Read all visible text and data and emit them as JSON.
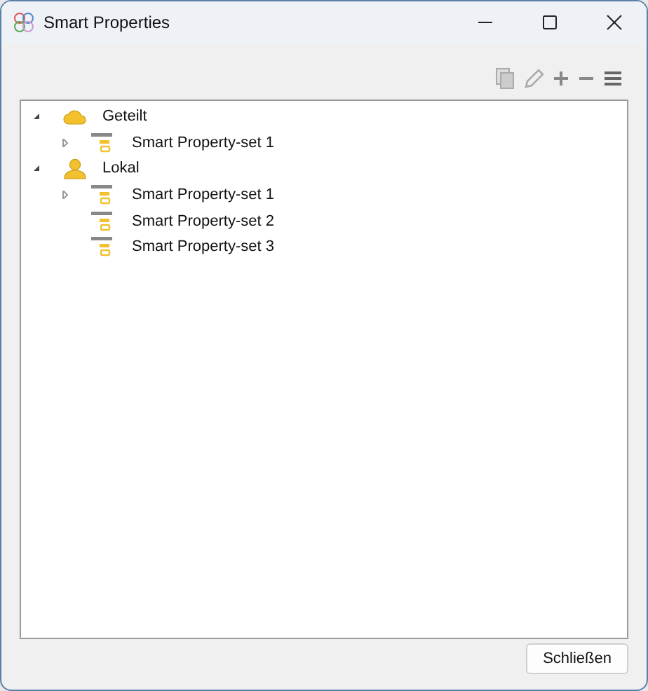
{
  "window": {
    "title": "Smart Properties"
  },
  "tree": [
    {
      "label": "Geteilt",
      "kind": "cloud",
      "expanded": true,
      "children": [
        {
          "label": "Smart Property-set 1",
          "expandable": true
        }
      ]
    },
    {
      "label": "Lokal",
      "kind": "user",
      "expanded": true,
      "children": [
        {
          "label": "Smart Property-set 1",
          "expandable": true
        },
        {
          "label": "Smart Property-set 2",
          "expandable": false
        },
        {
          "label": "Smart Property-set 3",
          "expandable": false
        }
      ]
    }
  ],
  "buttons": [
    "Schließen"
  ]
}
